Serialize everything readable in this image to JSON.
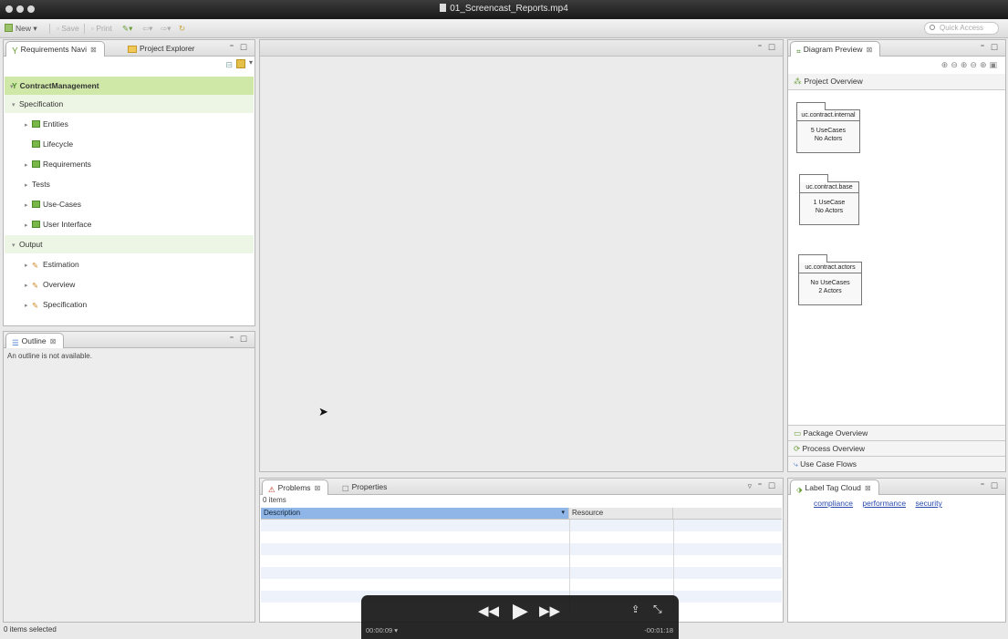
{
  "window": {
    "title": "01_Screencast_Reports.mp4"
  },
  "toolbar": {
    "new_label": "New",
    "save_label": "Save",
    "print_label": "Print",
    "quick_access_placeholder": "Quick Access"
  },
  "requirements_panel": {
    "tab_requirements": "Requirements Navi",
    "tab_project_explorer": "Project Explorer",
    "root": "ContractManagement",
    "items": [
      {
        "label": "Specification",
        "level": 1,
        "type": "folder"
      },
      {
        "label": "Entities",
        "level": 2,
        "type": "package"
      },
      {
        "label": "Lifecycle",
        "level": 2,
        "type": "package"
      },
      {
        "label": "Requirements",
        "level": 2,
        "type": "package"
      },
      {
        "label": "Tests",
        "level": 2,
        "type": "plain"
      },
      {
        "label": "Use-Cases",
        "level": 2,
        "type": "package"
      },
      {
        "label": "User Interface",
        "level": 2,
        "type": "package"
      },
      {
        "label": "Output",
        "level": 1,
        "type": "folder"
      },
      {
        "label": "Estimation",
        "level": 2,
        "type": "report"
      },
      {
        "label": "Overview",
        "level": 2,
        "type": "report"
      },
      {
        "label": "Specification",
        "level": 2,
        "type": "report"
      }
    ]
  },
  "outline_panel": {
    "tab": "Outline",
    "message": "An outline is not available."
  },
  "diagram_panel": {
    "tab": "Diagram Preview",
    "header": "Project Overview",
    "boxes": [
      {
        "name": "uc.contract.internal",
        "line1": "5 UseCases",
        "line2": "No Actors"
      },
      {
        "name": "uc.contract.base",
        "line1": "1 UseCase",
        "line2": "No Actors"
      },
      {
        "name": "uc.contract.actors",
        "line1": "No UseCases",
        "line2": "2 Actors"
      }
    ],
    "accordion": [
      "Package Overview",
      "Process Overview",
      "Use Case Flows"
    ]
  },
  "problems_panel": {
    "tab_problems": "Problems",
    "tab_properties": "Properties",
    "count": "0 items",
    "col_description": "Description",
    "col_resource": "Resource"
  },
  "tag_cloud_panel": {
    "tab": "Label Tag Cloud",
    "tags": [
      "compliance",
      "performance",
      "security"
    ]
  },
  "status": {
    "text": "0 items selected"
  },
  "video": {
    "elapsed": "00:00:09",
    "remaining": "-00:01:18"
  },
  "colors": {
    "accent_green": "#cfe8a8",
    "selection_blue": "#8fb6e6",
    "link_blue": "#2a4ab0"
  }
}
